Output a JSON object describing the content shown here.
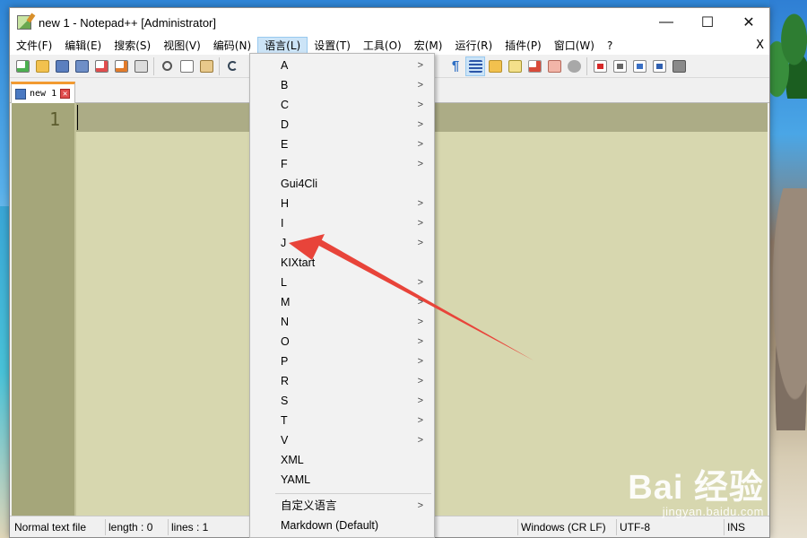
{
  "window": {
    "title": "new 1 - Notepad++ [Administrator]",
    "minimize": "—",
    "maximize": "☐",
    "close": "✕"
  },
  "menubar": {
    "items": [
      "文件(F)",
      "编辑(E)",
      "搜索(S)",
      "视图(V)",
      "编码(N)",
      "语言(L)",
      "设置(T)",
      "工具(O)",
      "宏(M)",
      "运行(R)",
      "插件(P)",
      "窗口(W)",
      "?"
    ],
    "active": "语言(L)",
    "close": "X"
  },
  "tab": {
    "label": "new 1",
    "close": "✕"
  },
  "editor": {
    "line_number": "1"
  },
  "statusbar": {
    "file_type": "Normal text file",
    "length": "length : 0",
    "lines": "lines : 1",
    "eol": "Windows (CR LF)",
    "encoding": "UTF-8",
    "mode": "INS"
  },
  "language_menu": {
    "items": [
      {
        "label": "A",
        "submenu": true
      },
      {
        "label": "B",
        "submenu": true
      },
      {
        "label": "C",
        "submenu": true
      },
      {
        "label": "D",
        "submenu": true
      },
      {
        "label": "E",
        "submenu": true
      },
      {
        "label": "F",
        "submenu": true
      },
      {
        "label": "Gui4Cli",
        "submenu": false
      },
      {
        "label": "H",
        "submenu": true
      },
      {
        "label": "I",
        "submenu": true
      },
      {
        "label": "J",
        "submenu": true
      },
      {
        "label": "KIXtart",
        "submenu": false
      },
      {
        "label": "L",
        "submenu": true
      },
      {
        "label": "M",
        "submenu": true
      },
      {
        "label": "N",
        "submenu": true
      },
      {
        "label": "O",
        "submenu": true
      },
      {
        "label": "P",
        "submenu": true
      },
      {
        "label": "R",
        "submenu": true
      },
      {
        "label": "S",
        "submenu": true
      },
      {
        "label": "T",
        "submenu": true
      },
      {
        "label": "V",
        "submenu": true
      },
      {
        "label": "XML",
        "submenu": false
      },
      {
        "label": "YAML",
        "submenu": false
      }
    ],
    "user_defined": "自定义语言",
    "markdown": "Markdown (Default)"
  },
  "watermark": {
    "logo": "Bai  经验",
    "url": "jingyan.baidu.com"
  },
  "colors": {
    "editor_bg": "#d7d7af",
    "gutter_bg": "#a5a67a",
    "current_line": "#acac86",
    "annotation_arrow": "#e8443a"
  }
}
